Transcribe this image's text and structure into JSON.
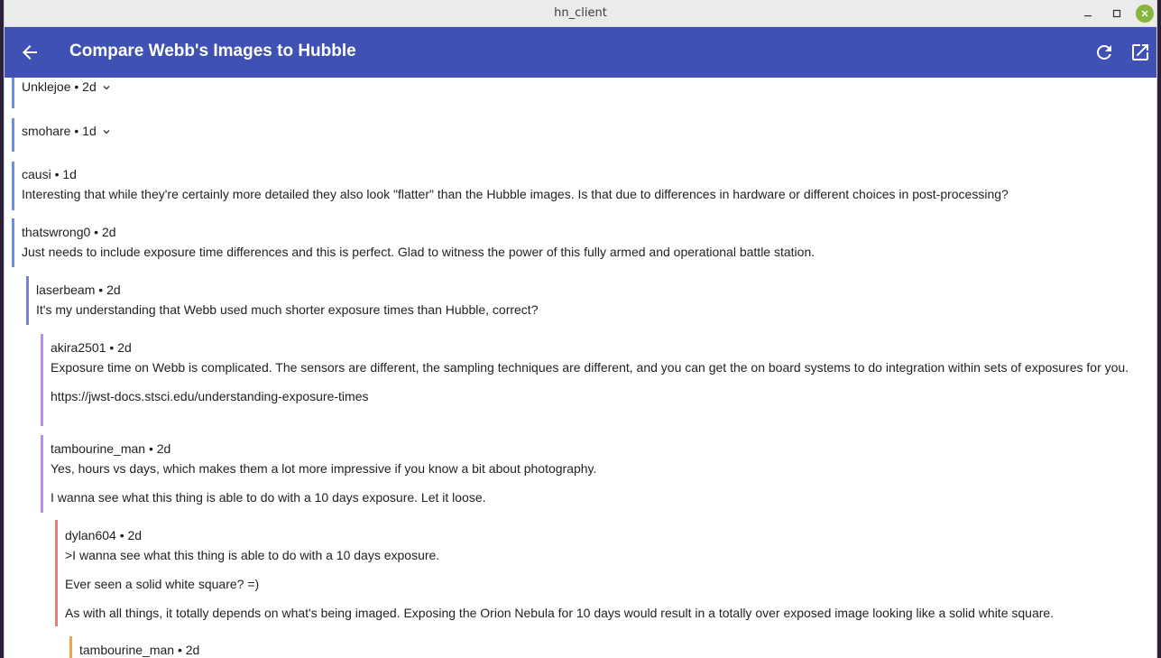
{
  "window": {
    "title": "hn_client"
  },
  "appbar": {
    "title": "Compare Webb's Images to Hubble"
  },
  "comments": [
    {
      "author": "Unklejoe",
      "age": "2d",
      "collapsed": true,
      "paragraphs": []
    },
    {
      "author": "smohare",
      "age": "1d",
      "collapsed": true,
      "paragraphs": []
    },
    {
      "author": "causi",
      "age": "1d",
      "paragraphs": [
        "Interesting that while they're certainly more detailed they also look \"flatter\" than the Hubble images. Is that due to differences in hardware or different choices in post-processing?"
      ]
    },
    {
      "author": "thatswrong0",
      "age": "2d",
      "paragraphs": [
        "Just needs to include exposure time differences and this is perfect. Glad to witness the power of this fully armed and operational battle station."
      ]
    },
    {
      "author": "laserbeam",
      "age": "2d",
      "paragraphs": [
        "It's my understanding that Webb used much shorter exposure times than Hubble, correct?"
      ]
    },
    {
      "author": "akira2501",
      "age": "2d",
      "paragraphs": [
        "Exposure time on Webb is complicated.  The sensors are different,  the sampling techniques are different,  and you can get the on board systems to do integration within sets of exposures for you.",
        "https://jwst-docs.stsci.edu/understanding-exposure-times"
      ]
    },
    {
      "author": "tambourine_man",
      "age": "2d",
      "paragraphs": [
        "Yes, hours vs days, which makes them a lot more impressive if you know a bit about photography.",
        "I wanna see what this thing is able to do with a 10 days exposure. Let it loose."
      ]
    },
    {
      "author": "dylan604",
      "age": "2d",
      "paragraphs": [
        ">I wanna see what this thing is able to do with a 10 days exposure.",
        "Ever seen a solid white square? =)",
        "As with all things, it totally depends on what's being imaged. Exposing the Orion Nebula for 10 days would result in a totally over exposed image looking like a solid white square."
      ]
    },
    {
      "author": "tambourine_man",
      "age": "2d",
      "paragraphs": []
    }
  ],
  "colors": {
    "appbar": "#3f51b5",
    "level0": "#6b8fe6",
    "level1": "#7b7fe0",
    "level2": "#b98cf0",
    "level3": "#ea7d7d",
    "level4": "#f0a24f",
    "link": "#1e88e5"
  },
  "icons": {
    "back": "arrow-back-icon",
    "refresh": "refresh-icon",
    "open": "open-in-new-icon",
    "collapse": "chevron-down-icon"
  }
}
